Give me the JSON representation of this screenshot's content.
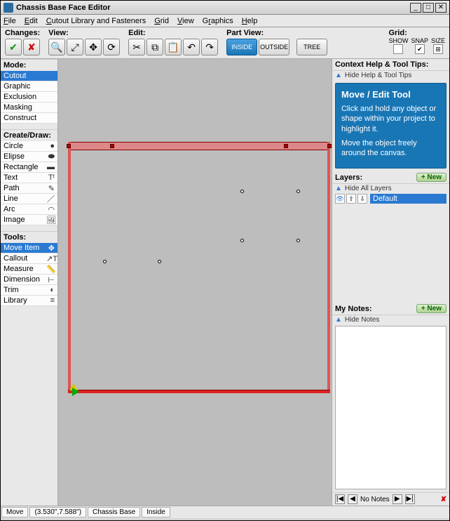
{
  "window": {
    "title": "Chassis Base Face Editor"
  },
  "menubar": {
    "file": "File",
    "edit": "Edit",
    "cutout": "Cutout Library and Fasteners",
    "grid": "Grid",
    "view": "View",
    "graphics": "Graphics",
    "help": "Help"
  },
  "toolbar": {
    "changes": "Changes:",
    "view": "View:",
    "edit": "Edit:",
    "partview": "Part View:",
    "inside": "INSIDE",
    "outside": "OUTSIDE",
    "tree": "TREE",
    "grid": "Grid:",
    "grid_show": "SHOW",
    "grid_snap": "SNAP",
    "grid_size": "SIZE"
  },
  "left": {
    "mode_label": "Mode:",
    "modes": {
      "cutout": "Cutout",
      "graphic": "Graphic",
      "exclusion": "Exclusion",
      "masking": "Masking",
      "construct": "Construct"
    },
    "create_label": "Create/Draw:",
    "create": {
      "circle": "Circle",
      "elipse": "Elipse",
      "rectangle": "Rectangle",
      "text": "Text",
      "path": "Path",
      "line": "Line",
      "arc": "Arc",
      "image": "Image"
    },
    "tools_label": "Tools:",
    "tools": {
      "move": "Move Item",
      "callout": "Callout",
      "measure": "Measure",
      "dimension": "Dimension",
      "trim": "Trim",
      "library": "Library"
    }
  },
  "context": {
    "header": "Context Help & Tool Tips:",
    "hide": "Hide Help & Tool Tips",
    "title": "Move / Edit Tool",
    "p1": "Click and hold any object or shape within your project to highlight it.",
    "p2": "Move the object freely around the canvas."
  },
  "layers": {
    "header": "Layers:",
    "new": "+ New",
    "hide": "Hide All Layers",
    "default": "Default"
  },
  "notes": {
    "header": "My Notes:",
    "new": "+ New",
    "hide": "Hide Notes",
    "none": "No Notes"
  },
  "status": {
    "mode": "Move",
    "coords": "(3.530\",7.588\")",
    "part": "Chassis Base",
    "side": "Inside"
  }
}
